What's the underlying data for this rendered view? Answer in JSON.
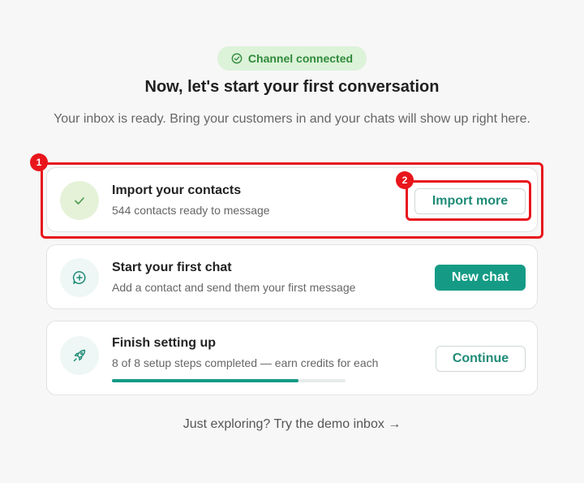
{
  "status_badge": {
    "label": "Channel connected",
    "icon": "check-circle-icon",
    "color": "#2f8a3a"
  },
  "header": {
    "title": "Now, let's start your first conversation",
    "subtitle": "Your inbox is ready. Bring your customers in and your chats will show up right here."
  },
  "cards": [
    {
      "icon": "check-icon",
      "title": "Import your contacts",
      "subtitle": "544 contacts ready to message",
      "button_label": "Import more"
    },
    {
      "icon": "chat-plus-icon",
      "title": "Start your first chat",
      "subtitle": "Add a contact and send them your first message",
      "button_label": "New chat"
    },
    {
      "icon": "rocket-icon",
      "title": "Finish setting up",
      "subtitle": "8 of 8 setup steps completed — earn credits for each",
      "button_label": "Continue",
      "progress": {
        "completed": 8,
        "total": 8,
        "fraction": 0.8
      }
    }
  ],
  "demo_link": {
    "label": "Just exploring? Try the demo inbox →"
  },
  "annotations": [
    {
      "number": "1"
    },
    {
      "number": "2"
    }
  ],
  "colors": {
    "accent": "#159b85",
    "highlight": "#e8161c",
    "badge_bg": "#dcf2d9"
  }
}
